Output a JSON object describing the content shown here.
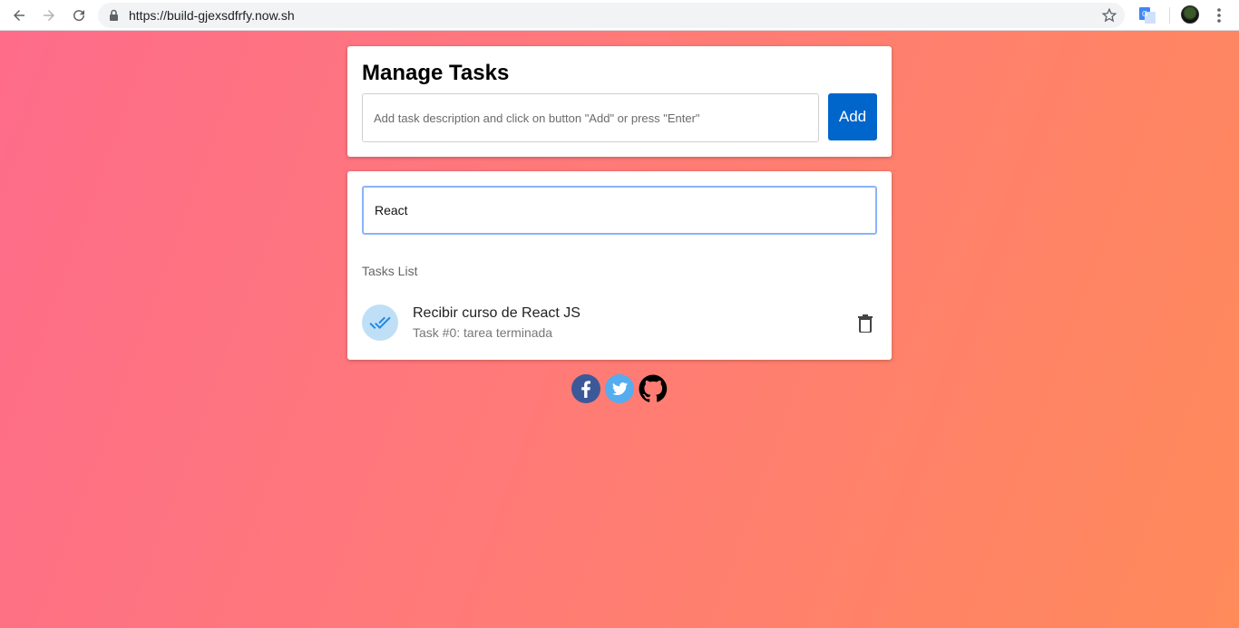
{
  "browser": {
    "url": "https://build-gjexsdfrfy.now.sh"
  },
  "manage": {
    "title": "Manage Tasks",
    "input_placeholder": "Add task description and click on button \"Add\" or press \"Enter\"",
    "input_value": "",
    "add_label": "Add"
  },
  "search": {
    "value": "React"
  },
  "list": {
    "header": "Tasks List",
    "items": [
      {
        "title": "Recibir curso de React JS",
        "subtitle": "Task #0: tarea terminada",
        "status_icon": "done-all-icon"
      }
    ]
  },
  "social": [
    "facebook-icon",
    "twitter-icon",
    "github-icon"
  ],
  "colors": {
    "add_button": "#0066cc",
    "avatar_bg": "#bfdff7",
    "search_border": "#8ab4f8",
    "gradient_start": "#fe6c8a",
    "gradient_end": "#ff8a5a"
  }
}
